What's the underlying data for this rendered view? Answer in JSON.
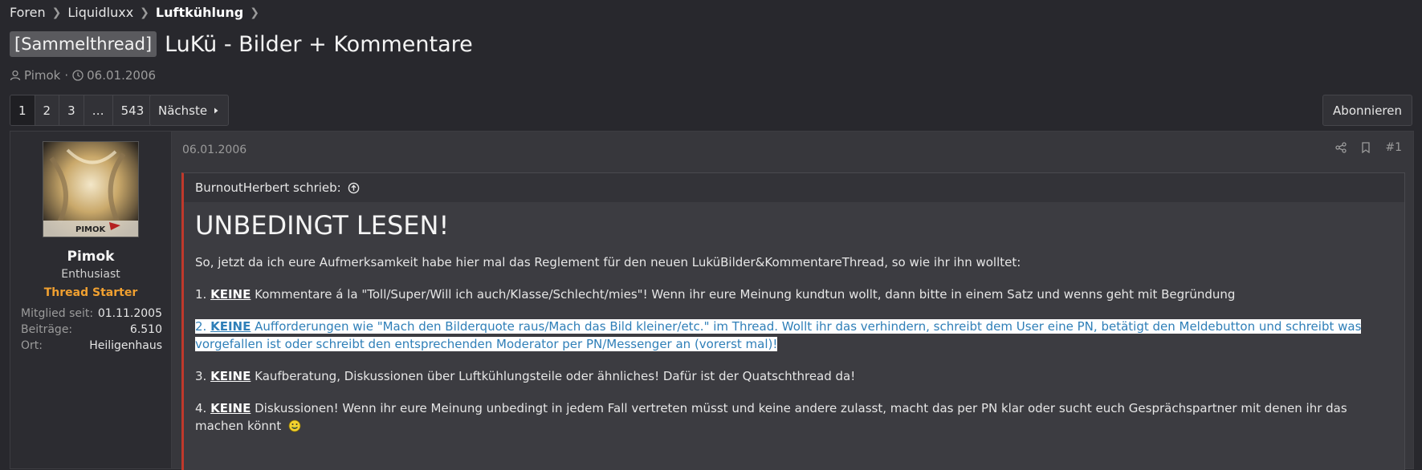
{
  "breadcrumb": {
    "items": [
      "Foren",
      "Liquidluxx",
      "Luftkühlung"
    ]
  },
  "thread": {
    "prefix": "[Sammelthread]",
    "title": "LuKü - Bilder + Kommentare",
    "author": "Pimok",
    "separator": "·",
    "date": "06.01.2006"
  },
  "pagination": {
    "pages": [
      "1",
      "2",
      "3",
      "…",
      "543"
    ],
    "next_label": "Nächste"
  },
  "subscribe_label": "Abonnieren",
  "user": {
    "name": "Pimok",
    "title": "Enthusiast",
    "badge": "Thread Starter",
    "stats": [
      {
        "label": "Mitglied seit:",
        "value": "01.11.2005"
      },
      {
        "label": "Beiträge:",
        "value": "6.510"
      },
      {
        "label": "Ort:",
        "value": "Heiligenhaus"
      }
    ],
    "avatar_text": "PIMOK"
  },
  "post": {
    "date": "06.01.2006",
    "number": "#1",
    "quote_author": "BurnoutHerbert schrieb:",
    "heading": "UNBEDINGT LESEN!",
    "intro": "So, jetzt da ich eure Aufmerksamkeit habe hier mal das Reglement für den neuen LuküBilder&KommentareThread, so wie ihr ihn wolltet:",
    "rules": [
      {
        "num": "1.",
        "keyword": "KEINE",
        "text": " Kommentare á la \"Toll/Super/Will ich auch/Klasse/Schlecht/mies\"! Wenn ihr eure Meinung kundtun wollt, dann bitte in einem Satz und wenns geht mit Begründung"
      },
      {
        "num": "2.",
        "keyword": "KEINE",
        "text": " Aufforderungen wie \"Mach den Bilderquote raus/Mach das Bild kleiner/etc.\" im Thread. Wollt ihr das verhindern, schreibt dem User eine PN, betätigt den Meldebutton und schreibt was vorgefallen ist oder schreibt den entsprechenden Moderator per PN/Messenger an (vorerst mal)!"
      },
      {
        "num": "3.",
        "keyword": "KEINE",
        "text": " Kaufberatung, Diskussionen über Luftkühlungsteile oder ähnliches! Dafür ist der Quatschthread da!"
      },
      {
        "num": "4.",
        "keyword": "KEINE",
        "text": " Diskussionen! Wenn ihr eure Meinung unbedingt in jedem Fall vertreten müsst und keine andere zulasst, macht das per PN klar oder sucht euch Gesprächspartner mit denen ihr das machen könnt"
      }
    ]
  },
  "colors": {
    "background": "#28282d",
    "thread_starter": "#f0a030",
    "quote_border": "#c0392b",
    "link_highlight": "#2f7fb8"
  }
}
